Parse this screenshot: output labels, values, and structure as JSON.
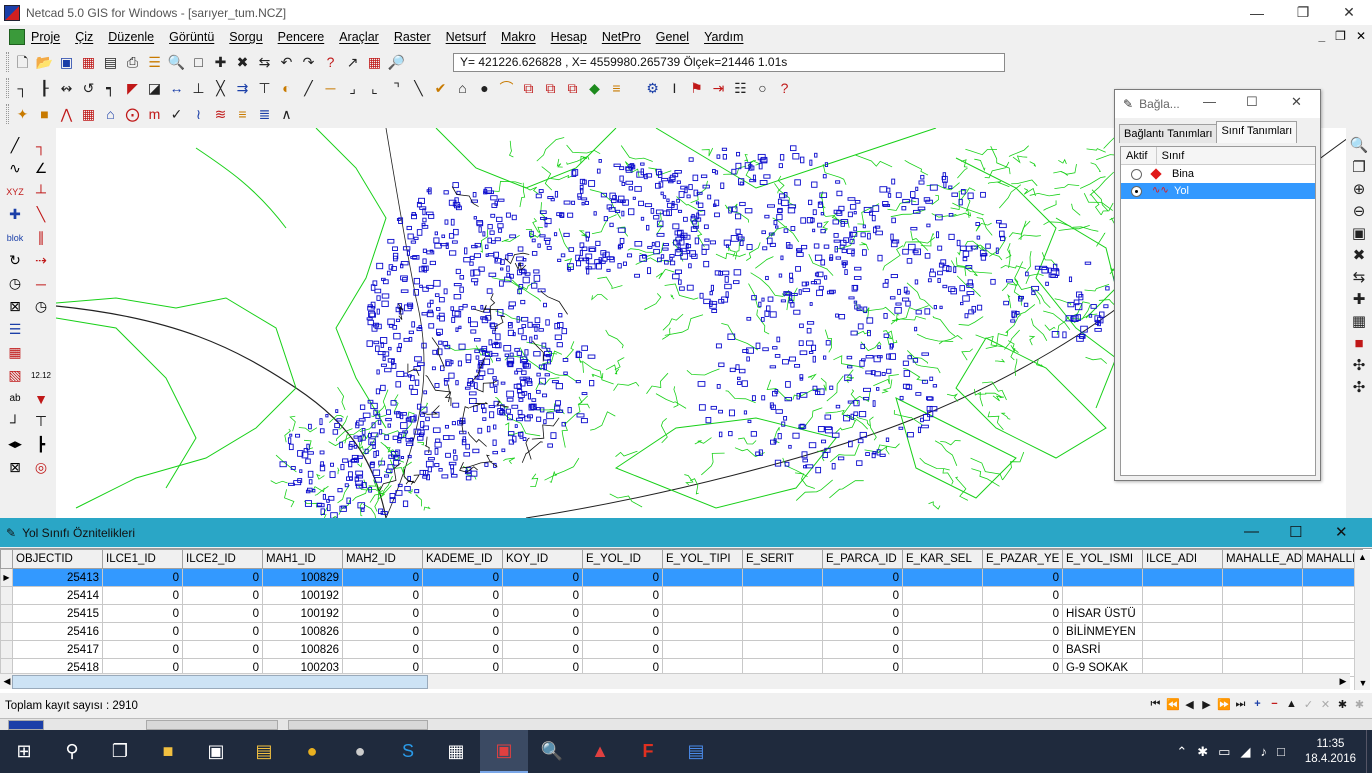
{
  "window": {
    "title": "Netcad 5.0 GIS for Windows - [sarıyer_tum.NCZ]"
  },
  "menu": [
    "Proje",
    "Çiz",
    "Düzenle",
    "Görüntü",
    "Sorgu",
    "Pencere",
    "Araçlar",
    "Raster",
    "Netsurf",
    "Makro",
    "Hesap",
    "NetPro",
    "Genel",
    "Yardım"
  ],
  "coord_readout": "Y= 421226.626828 , X= 4559980.265739 Ölçek=21446   1.01s",
  "dialog": {
    "title": "Bağla...",
    "tabs": [
      "Bağlantı Tanımları",
      "Sınıf Tanımları"
    ],
    "active_tab": 1,
    "columns": [
      "Aktif",
      "Sınıf"
    ],
    "rows": [
      {
        "label": "Bina",
        "active": false,
        "selected": false
      },
      {
        "label": "Yol",
        "active": true,
        "selected": true
      }
    ]
  },
  "attributes": {
    "title": "Yol Sınıfı Öznitelikleri",
    "columns": [
      "OBJECTID",
      "ILCE1_ID",
      "ILCE2_ID",
      "MAH1_ID",
      "MAH2_ID",
      "KADEME_ID",
      "KOY_ID",
      "E_YOL_ID",
      "E_YOL_TIPI",
      "E_SERIT",
      "E_PARCA_ID",
      "E_KAR_SEL",
      "E_PAZAR_YE",
      "E_YOL_ISMI",
      "ILCE_ADI",
      "MAHALLE_AD",
      "MAHALLE"
    ],
    "rows": [
      [
        "25413",
        "0",
        "0",
        "100829",
        "0",
        "0",
        "0",
        "0",
        "",
        "",
        "0",
        "",
        "0",
        "",
        "",
        "",
        ""
      ],
      [
        "25414",
        "0",
        "0",
        "100192",
        "0",
        "0",
        "0",
        "0",
        "",
        "",
        "0",
        "",
        "0",
        "",
        "",
        "",
        ""
      ],
      [
        "25415",
        "0",
        "0",
        "100192",
        "0",
        "0",
        "0",
        "0",
        "",
        "",
        "0",
        "",
        "0",
        "HİSAR ÜSTÜ",
        "",
        "",
        ""
      ],
      [
        "25416",
        "0",
        "0",
        "100826",
        "0",
        "0",
        "0",
        "0",
        "",
        "",
        "0",
        "",
        "0",
        "BİLİNMEYEN",
        "",
        "",
        ""
      ],
      [
        "25417",
        "0",
        "0",
        "100826",
        "0",
        "0",
        "0",
        "0",
        "",
        "",
        "0",
        "",
        "0",
        "BASRİ",
        "",
        "",
        ""
      ],
      [
        "25418",
        "0",
        "0",
        "100203",
        "0",
        "0",
        "0",
        "0",
        "",
        "",
        "0",
        "",
        "0",
        "G-9 SOKAK",
        "",
        "",
        ""
      ]
    ],
    "selected_row": 0,
    "status": "Toplam kayıt sayısı : 2910"
  },
  "taskbar": {
    "time": "11:35",
    "date": "18.4.2016"
  },
  "colors": {
    "building": "#0a0acc",
    "road": "#18d018",
    "selection": "#3399ff",
    "panel_title": "#2aa6c6"
  }
}
